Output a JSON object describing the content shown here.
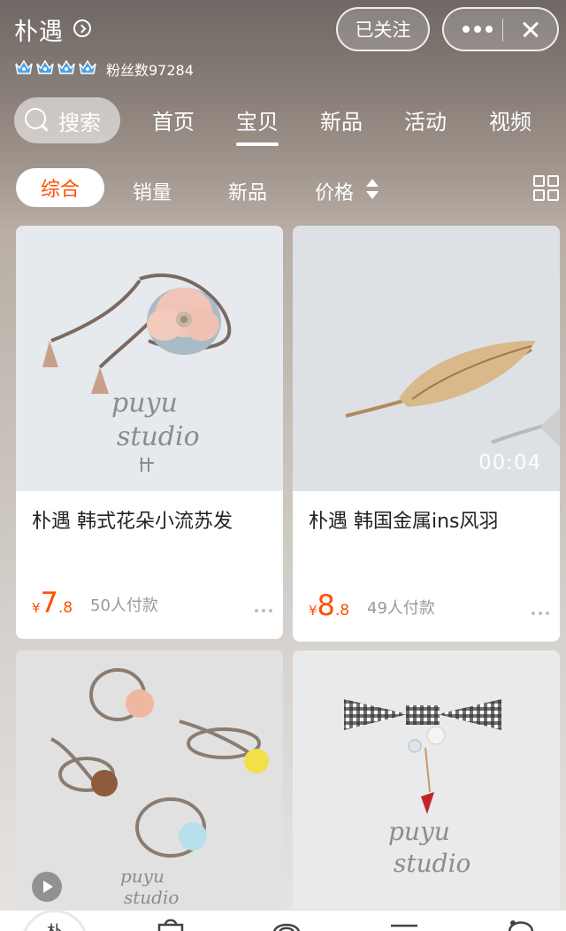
{
  "header": {
    "shop_name": "朴遇",
    "fans_text": "粉丝数97284",
    "follow_label": "已关注",
    "crown_count": 4
  },
  "nav": {
    "search_label": "搜索",
    "items": [
      {
        "label": "首页",
        "active": false
      },
      {
        "label": "宝贝",
        "active": true
      },
      {
        "label": "新品",
        "active": false
      },
      {
        "label": "活动",
        "active": false
      },
      {
        "label": "视频",
        "active": false
      }
    ]
  },
  "sort": {
    "items": [
      "综合",
      "销量",
      "新品",
      "价格"
    ],
    "active": "综合"
  },
  "products": [
    {
      "title": "朴遇 韩式花朵小流苏发",
      "currency": "¥",
      "price_int": "7",
      "price_dec": ".8",
      "sold": "50人付款",
      "watermark": [
        "puyu",
        "studio"
      ]
    },
    {
      "title": "朴遇 韩国金属ins风羽",
      "currency": "¥",
      "price_int": "8",
      "price_dec": ".8",
      "sold": "49人付款",
      "video_duration": "00:04"
    },
    {
      "watermark": [
        "puyu",
        "studio"
      ]
    },
    {
      "watermark": [
        "puyu",
        "studio"
      ]
    }
  ],
  "tabbar": {
    "avatar_text": "朴"
  },
  "colors": {
    "accent": "#ff5000",
    "crown": "#4aa3e8"
  }
}
